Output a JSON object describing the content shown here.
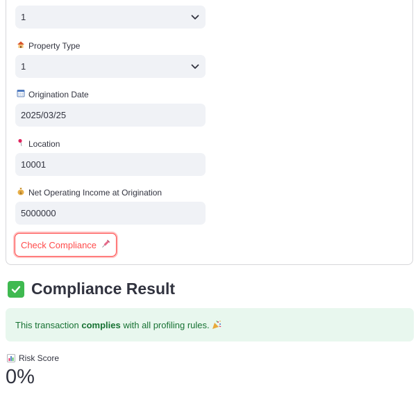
{
  "form": {
    "top_select": {
      "value": "1",
      "icon": "chevron-down-icon"
    },
    "property_type": {
      "label": "Property Type",
      "icon": "house-icon",
      "value": "1"
    },
    "origination_date": {
      "label": "Origination Date",
      "icon": "calendar-icon",
      "value": "2025/03/25"
    },
    "location": {
      "label": "Location",
      "icon": "pin-icon",
      "value": "10001"
    },
    "noi": {
      "label": "Net Operating Income at Origination",
      "icon": "money-bag-icon",
      "value": "5000000"
    },
    "submit": {
      "label": "Check Compliance",
      "icon": "syringe-icon"
    }
  },
  "result": {
    "title": "Compliance Result",
    "icon": "check-mark-icon",
    "message_prefix": "This transaction ",
    "message_bold": "complies",
    "message_suffix": " with all profiling rules. ",
    "message_icon": "party-popper-icon"
  },
  "metric": {
    "label": "Risk Score",
    "icon": "bar-chart-icon",
    "value": "0%"
  },
  "colors": {
    "accent": "#ff4b4b",
    "input_bg": "#f0f2f6",
    "success_bg": "#e8f7ee",
    "success_text": "#177233",
    "check_green": "#3fb950"
  }
}
